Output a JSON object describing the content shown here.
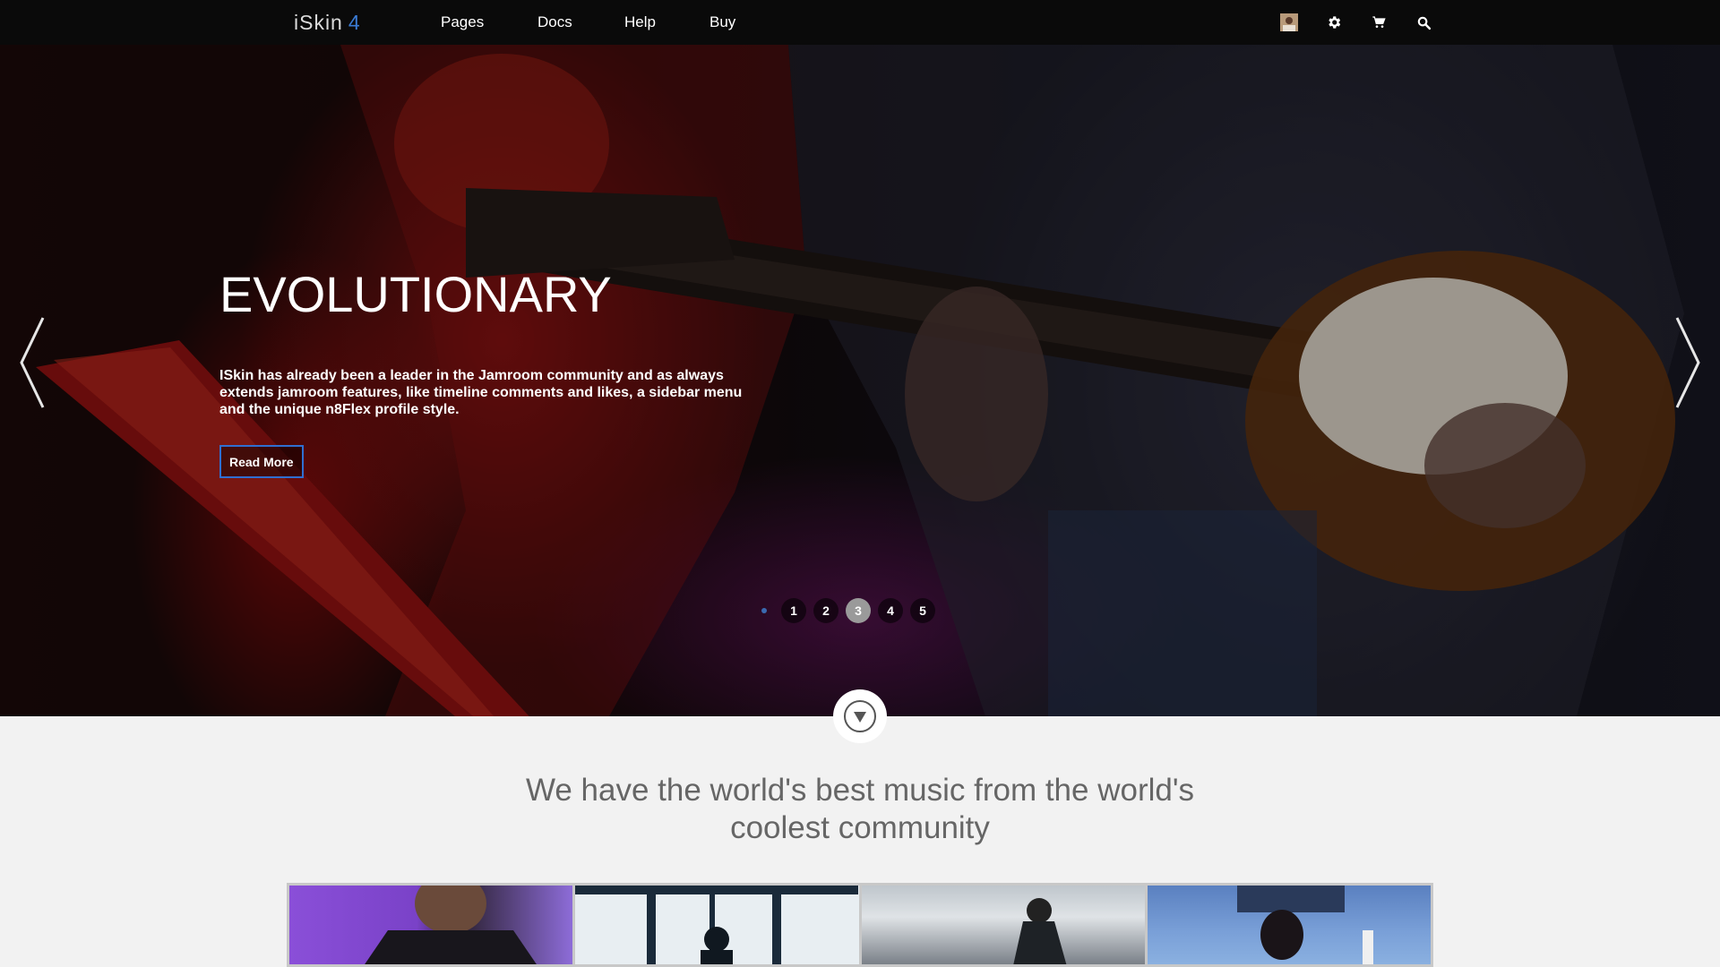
{
  "header": {
    "logo_name": "iSkin",
    "logo_version": "4",
    "nav": [
      "Pages",
      "Docs",
      "Help",
      "Buy"
    ],
    "icons": [
      "user-avatar-icon",
      "gear-icon",
      "cart-icon",
      "search-icon"
    ]
  },
  "hero": {
    "title": "EVOLUTIONARY",
    "text": "ISkin has already been a leader in the Jamroom community and as always extends jamroom features, like timeline comments and likes, a sidebar menu and the unique n8Flex profile style.",
    "button": "Read More",
    "slides": [
      "1",
      "2",
      "3",
      "4",
      "5"
    ],
    "active_slide": "3"
  },
  "section": {
    "headline_line1": "We have the world's best music from the world's",
    "headline_line2": "coolest community"
  },
  "colors": {
    "accent": "#2f6fd1",
    "topbar": "#0a0a0a",
    "page_bg": "#f2f2f2"
  }
}
